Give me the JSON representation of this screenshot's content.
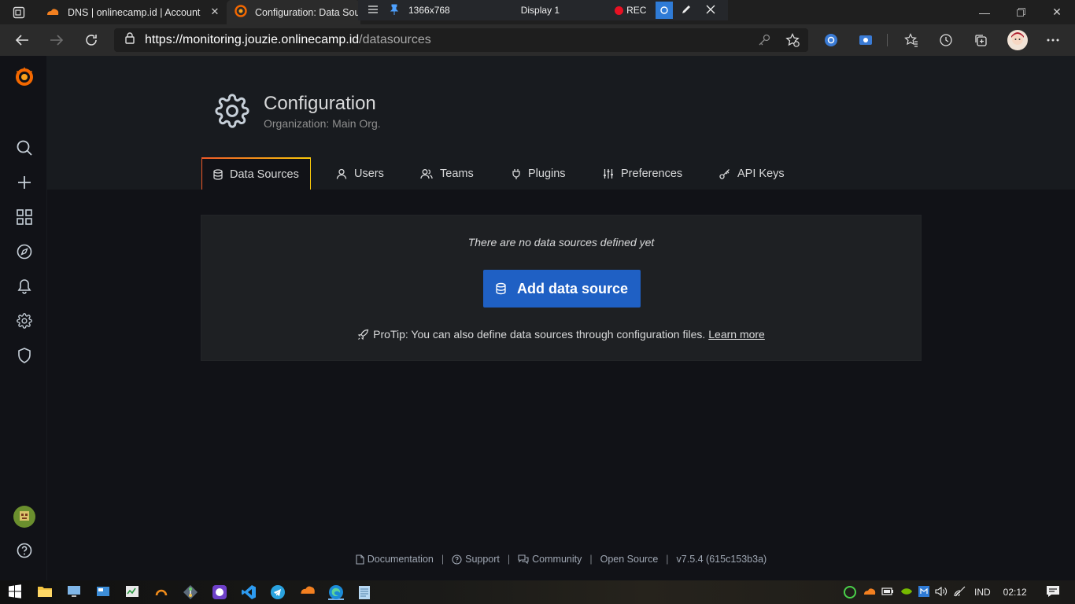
{
  "browser": {
    "tabs": [
      {
        "title": "DNS | onlinecamp.id | Account | C"
      },
      {
        "title": "Configuration: Data Sou"
      }
    ],
    "recorder": {
      "resolution": "1366x768",
      "display": "Display 1",
      "rec_label": "REC"
    },
    "url_host": "https://monitoring.jouzie.onlinecamp.id",
    "url_path": "/datasources"
  },
  "header": {
    "title": "Configuration",
    "subtitle": "Organization: Main Org."
  },
  "tabs": [
    {
      "label": "Data Sources",
      "icon": "database-icon",
      "active": true
    },
    {
      "label": "Users",
      "icon": "user-icon"
    },
    {
      "label": "Teams",
      "icon": "users-icon"
    },
    {
      "label": "Plugins",
      "icon": "plug-icon"
    },
    {
      "label": "Preferences",
      "icon": "sliders-icon"
    },
    {
      "label": "API Keys",
      "icon": "key-icon"
    }
  ],
  "empty_state": {
    "title": "There are no data sources defined yet",
    "button_label": "Add data source",
    "protip": "ProTip: You can also define data sources through configuration files.",
    "learn_more": "Learn more"
  },
  "footer": {
    "documentation": "Documentation",
    "support": "Support",
    "community": "Community",
    "open_source": "Open Source",
    "version": "v7.5.4 (615c153b3a)"
  },
  "taskbar": {
    "language": "IND",
    "time": "02:12"
  },
  "colors": {
    "accent_button": "#1f60c4",
    "tab_highlight": "#f58b2d",
    "grafana_orange": "#f46800"
  }
}
